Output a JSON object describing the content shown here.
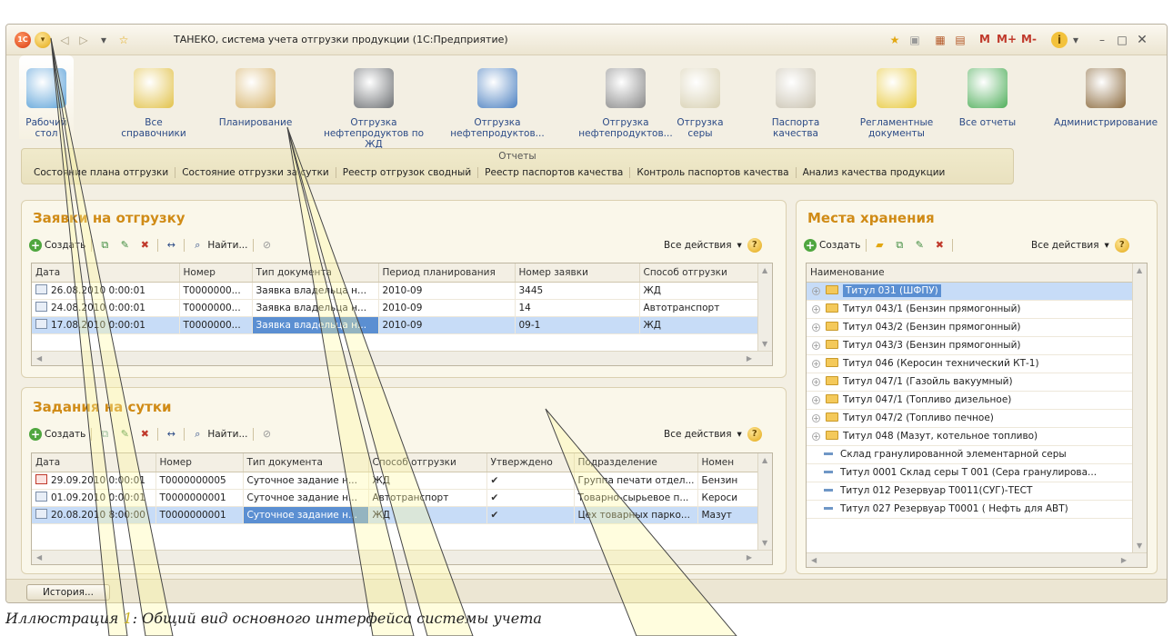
{
  "window": {
    "title": "ТАНЕКО, система учета отгрузки продукции  (1С:Предприятие)",
    "logo": "1С",
    "m_buttons": [
      "M",
      "M+",
      "M-"
    ]
  },
  "sections": [
    {
      "label": "Рабочий стол",
      "icon": "desk-lamp-icon",
      "color": "#5aa1d8"
    },
    {
      "label": "Все справочники",
      "icon": "binders-icon",
      "color": "#e2c24a"
    },
    {
      "label": "Планирование",
      "icon": "folder-notebook-icon",
      "color": "#d7b36a"
    },
    {
      "label": "Отгрузка нефтепродуктов по ЖД",
      "icon": "rail-tank-car-icon",
      "color": "#6d7073"
    },
    {
      "label": "Отгрузка нефтепродуктов...",
      "icon": "tank-truck-icon",
      "color": "#4a7fc0"
    },
    {
      "label": "Отгрузка нефтепродуктов...",
      "icon": "pipe-valve-icon",
      "color": "#888888"
    },
    {
      "label": "Отгрузка серы",
      "icon": "sack-icon",
      "color": "#d7cfb0"
    },
    {
      "label": "Паспорта качества",
      "icon": "clipboard-check-icon",
      "color": "#c9c2b0"
    },
    {
      "label": "Регламентные документы",
      "icon": "database-gear-icon",
      "color": "#e8c93c"
    },
    {
      "label": "Все отчеты",
      "icon": "pie-chart-icon",
      "color": "#4fae5a"
    },
    {
      "label": "Администрирование",
      "icon": "admin-user-icon",
      "color": "#8b6a3d"
    }
  ],
  "reports": {
    "title": "Отчеты",
    "links": [
      "Состояние плана отгрузки",
      "Состояние отгрузки за сутки",
      "Реестр отгрузок сводный",
      "Реестр паспортов качества",
      "Контроль паспортов качества",
      "Анализ качества продукции"
    ]
  },
  "orders": {
    "title": "Заявки на отгрузку",
    "create": "Создать",
    "find": "Найти...",
    "all_actions": "Все действия",
    "columns": [
      "Дата",
      "Номер",
      "Тип документа",
      "Период планирования",
      "Номер заявки",
      "Способ отгрузки"
    ],
    "rows": [
      [
        "26.08.2010 0:00:01",
        "Т0000000...",
        "Заявка владельца н...",
        "2010-09",
        "3445",
        "ЖД"
      ],
      [
        "24.08.2010 0:00:01",
        "Т0000000...",
        "Заявка владельца н...",
        "2010-09",
        "14",
        "Автотранспорт"
      ],
      [
        "17.08.2010 0:00:01",
        "Т0000000...",
        "Заявка владельца н...",
        "2010-09",
        "09-1",
        "ЖД"
      ]
    ]
  },
  "tasks": {
    "title": "Задания на сутки",
    "create": "Создать",
    "find": "Найти...",
    "all_actions": "Все действия",
    "columns": [
      "Дата",
      "Номер",
      "Тип документа",
      "Способ отгрузки",
      "Утверждено",
      "Подразделение",
      "Номен"
    ],
    "rows": [
      [
        "29.09.2010 0:00:01",
        "Т0000000005",
        "Суточное задание н...",
        "ЖД",
        "✔",
        "Группа печати отдел...",
        "Бензин"
      ],
      [
        "01.09.2010 0:00:01",
        "Т0000000001",
        "Суточное задание н...",
        "Автотранспорт",
        "✔",
        "Товарно-сырьевое п...",
        "Кероси"
      ],
      [
        "20.08.2010 8:00:00",
        "Т0000000001",
        "Суточное задание н...",
        "ЖД",
        "✔",
        "Цех товарных парко...",
        "Мазут"
      ]
    ]
  },
  "storage": {
    "title": "Места хранения",
    "create": "Создать",
    "all_actions": "Все действия",
    "column": "Наименование",
    "folders": [
      "Титул 031 (ШФПУ)",
      "Титул 043/1 (Бензин прямогонный)",
      "Титул 043/2 (Бензин прямогонный)",
      "Титул 043/3 (Бензин прямогонный)",
      "Титул 046 (Керосин технический КТ-1)",
      "Титул 047/1 (Газойль вакуумный)",
      "Титул 047/1 (Топливо  дизельное)",
      "Титул 047/2 (Топливо печное)",
      "Титул 048 (Мазут, котельное топливо)"
    ],
    "items": [
      "Склад гранулированной элементарной серы",
      "Титул 0001 Склад серы Т 001 (Сера гранулирова...",
      "Титул 012 Резервуар Т0011(СУГ)-ТЕСТ",
      "Титул 027 Резервуар Т0001 ( Нефть для АВТ)"
    ]
  },
  "history_button": "История...",
  "caption": {
    "prefix": "Иллюстрация ",
    "number": "1",
    "text": ": Общий вид основного интерфейса системы учета"
  }
}
